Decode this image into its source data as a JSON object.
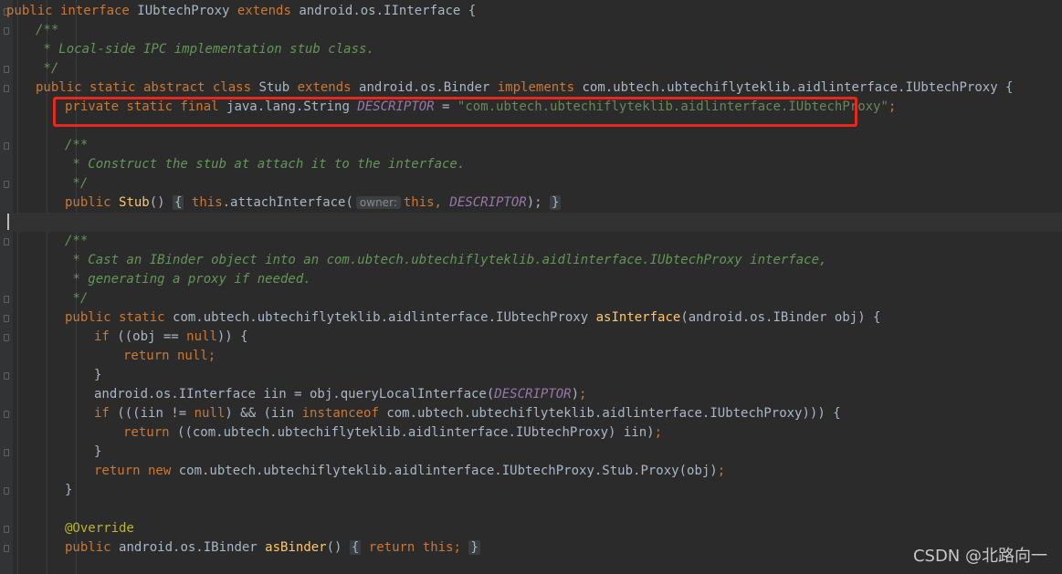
{
  "editor": {
    "lines": [
      {
        "parts": [
          [
            "kw",
            "public interface "
          ],
          [
            "p",
            "IUbtechProxy "
          ],
          [
            "kw",
            "extends "
          ],
          [
            "p",
            "android.os.IInterface {"
          ]
        ]
      },
      {
        "indent": 1,
        "parts": [
          [
            "cm",
            "/**"
          ]
        ]
      },
      {
        "indent": 1,
        "parts": [
          [
            "cm",
            " * Local-side IPC implementation stub class."
          ]
        ]
      },
      {
        "indent": 1,
        "parts": [
          [
            "cm",
            " */"
          ]
        ]
      },
      {
        "indent": 1,
        "parts": [
          [
            "kw",
            "public static abstract class "
          ],
          [
            "p",
            "Stub "
          ],
          [
            "kw",
            "extends "
          ],
          [
            "p",
            "android.os.Binder "
          ],
          [
            "kw",
            "implements "
          ],
          [
            "p",
            "com.ubtech.ubtechiflyteklib.aidlinterface.IUbtechProxy {"
          ]
        ]
      },
      {
        "indent": 2,
        "parts": [
          [
            "kw",
            "private static final "
          ],
          [
            "p",
            "java.lang.String "
          ],
          [
            "cst",
            "DESCRIPTOR"
          ],
          [
            "p",
            " = "
          ],
          [
            "str",
            "\"com.ubtech.ubtechiflyteklib.aidlinterface.IUbtechProxy\""
          ],
          [
            "kw",
            ";"
          ]
        ]
      },
      {
        "indent": 2,
        "parts": []
      },
      {
        "indent": 2,
        "parts": [
          [
            "cm",
            "/**"
          ]
        ]
      },
      {
        "indent": 2,
        "parts": [
          [
            "cm",
            " * Construct the stub at attach it to the interface."
          ]
        ]
      },
      {
        "indent": 2,
        "parts": [
          [
            "cm",
            " */"
          ]
        ]
      },
      {
        "indent": 2,
        "parts": [
          [
            "kw",
            "public "
          ],
          [
            "fn",
            "Stub"
          ],
          [
            "p",
            "() "
          ],
          [
            "box",
            "{"
          ],
          [
            "p",
            " "
          ],
          [
            "kw",
            "this"
          ],
          [
            "p",
            ".attachInterface("
          ],
          [
            "hint",
            "owner:"
          ],
          [
            "kw",
            "this, "
          ],
          [
            "cst",
            "DESCRIPTOR"
          ],
          [
            "p",
            ");"
          ],
          [
            "p",
            " "
          ],
          [
            "box",
            "}"
          ]
        ]
      },
      {
        "indent": 2,
        "parts": [],
        "current": true
      },
      {
        "indent": 2,
        "parts": [
          [
            "cm",
            "/**"
          ]
        ]
      },
      {
        "indent": 2,
        "parts": [
          [
            "cm",
            " * Cast an IBinder object into an com.ubtech.ubtechiflyteklib.aidlinterface.IUbtechProxy interface,"
          ]
        ]
      },
      {
        "indent": 2,
        "parts": [
          [
            "cm",
            " * generating a proxy if needed."
          ]
        ]
      },
      {
        "indent": 2,
        "parts": [
          [
            "cm",
            " */"
          ]
        ]
      },
      {
        "indent": 2,
        "parts": [
          [
            "kw",
            "public static "
          ],
          [
            "p",
            "com.ubtech.ubtechiflyteklib.aidlinterface.IUbtechProxy "
          ],
          [
            "fn",
            "asInterface"
          ],
          [
            "p",
            "(android.os.IBinder obj) {"
          ]
        ]
      },
      {
        "indent": 3,
        "parts": [
          [
            "kw",
            "if "
          ],
          [
            "p",
            "((obj == "
          ],
          [
            "kw",
            "null"
          ],
          [
            "p",
            ")) {"
          ]
        ]
      },
      {
        "indent": 4,
        "parts": [
          [
            "kw",
            "return null;"
          ]
        ]
      },
      {
        "indent": 3,
        "parts": [
          [
            "p",
            "}"
          ]
        ]
      },
      {
        "indent": 3,
        "parts": [
          [
            "p",
            "android.os.IInterface iin = obj.queryLocalInterface("
          ],
          [
            "cst",
            "DESCRIPTOR"
          ],
          [
            "p",
            ")"
          ],
          [
            "kw",
            ";"
          ]
        ]
      },
      {
        "indent": 3,
        "parts": [
          [
            "kw",
            "if "
          ],
          [
            "p",
            "(((iin != "
          ],
          [
            "kw",
            "null"
          ],
          [
            "p",
            ") && (iin "
          ],
          [
            "kw",
            "instanceof "
          ],
          [
            "p",
            "com.ubtech.ubtechiflyteklib.aidlinterface.IUbtechProxy))) {"
          ]
        ]
      },
      {
        "indent": 4,
        "parts": [
          [
            "kw",
            "return "
          ],
          [
            "p",
            "((com.ubtech.ubtechiflyteklib.aidlinterface.IUbtechProxy) iin)"
          ],
          [
            "kw",
            ";"
          ]
        ]
      },
      {
        "indent": 3,
        "parts": [
          [
            "p",
            "}"
          ]
        ]
      },
      {
        "indent": 3,
        "parts": [
          [
            "kw",
            "return new "
          ],
          [
            "p",
            "com.ubtech.ubtechiflyteklib.aidlinterface.IUbtechProxy.Stub.Proxy(obj)"
          ],
          [
            "kw",
            ";"
          ]
        ]
      },
      {
        "indent": 2,
        "parts": [
          [
            "p",
            "}"
          ]
        ]
      },
      {
        "indent": 2,
        "parts": []
      },
      {
        "indent": 2,
        "parts": [
          [
            "ann",
            "@Override"
          ]
        ]
      },
      {
        "indent": 2,
        "parts": [
          [
            "kw",
            "public "
          ],
          [
            "p",
            "android.os.IBinder "
          ],
          [
            "fn",
            "asBinder"
          ],
          [
            "p",
            "() "
          ],
          [
            "box",
            "{"
          ],
          [
            "p",
            " "
          ],
          [
            "kw",
            "return this;"
          ],
          [
            "p",
            " "
          ],
          [
            "box",
            "}"
          ]
        ]
      }
    ]
  },
  "watermark": "CSDN @北路向一",
  "colors": {
    "background": "#2b2b2b",
    "keyword": "#cc7832",
    "comment": "#629755",
    "function": "#ffc66d",
    "constant": "#9876aa",
    "string": "#6a8759",
    "highlight_border": "#e8281d"
  }
}
